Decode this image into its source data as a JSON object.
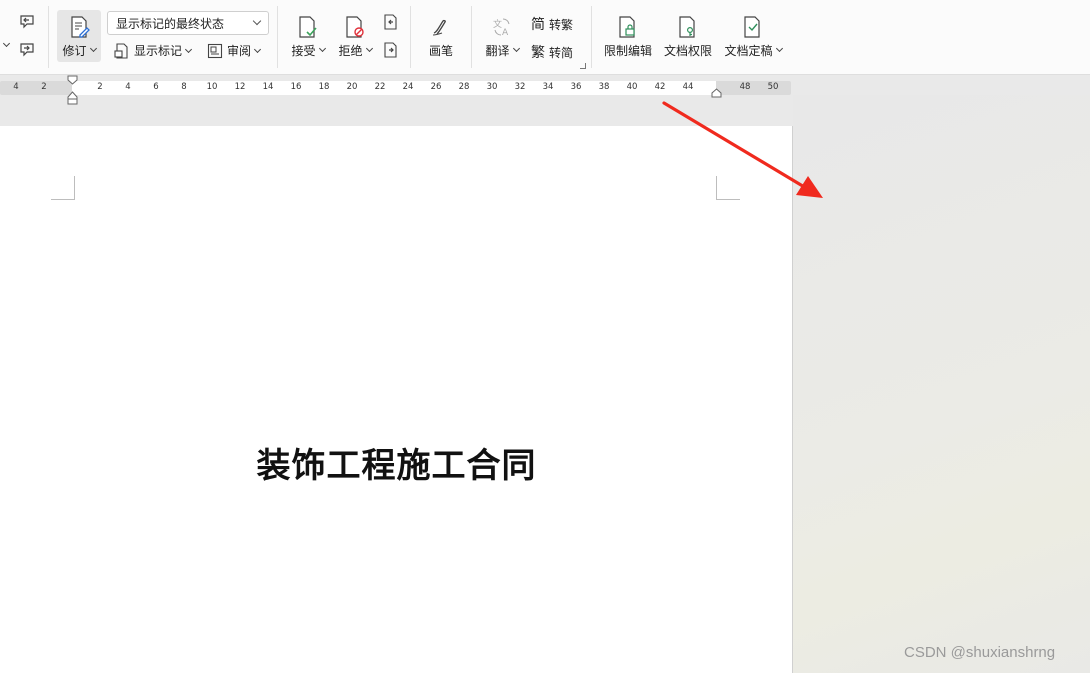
{
  "ribbon": {
    "revise": {
      "label": "修订"
    },
    "markup_select": {
      "value": "显示标记的最终状态"
    },
    "show_markup": {
      "label": "显示标记"
    },
    "review_pane": {
      "label": "审阅"
    },
    "accept": {
      "label": "接受"
    },
    "reject": {
      "label": "拒绝"
    },
    "ink": {
      "label": "画笔"
    },
    "translate": {
      "label": "翻译"
    },
    "to_traditional": {
      "label": "转繁",
      "icon_char": "简"
    },
    "to_simplified": {
      "label": "转简",
      "icon_char": "繁"
    },
    "restrict_edit": {
      "label": "限制编辑"
    },
    "doc_permission": {
      "label": "文档权限"
    },
    "doc_finalize": {
      "label": "文档定稿"
    }
  },
  "ruler": {
    "left_ticks": [
      "4",
      "2"
    ],
    "ticks": [
      "2",
      "4",
      "6",
      "8",
      "10",
      "12",
      "14",
      "16",
      "18",
      "20",
      "22",
      "24",
      "26",
      "28",
      "30",
      "32",
      "34",
      "36",
      "38",
      "40",
      "42",
      "44"
    ],
    "right_ticks": [
      "48",
      "50"
    ]
  },
  "document": {
    "title": "装饰工程施工合同"
  },
  "watermark": "CSDN @shuxianshrng",
  "colors": {
    "accent_blue": "#2b6fd6",
    "accept_green": "#3aa35a",
    "reject_red": "#e0303a",
    "lock_green": "#2f8f5b",
    "arrow_red": "#f02a1e"
  }
}
